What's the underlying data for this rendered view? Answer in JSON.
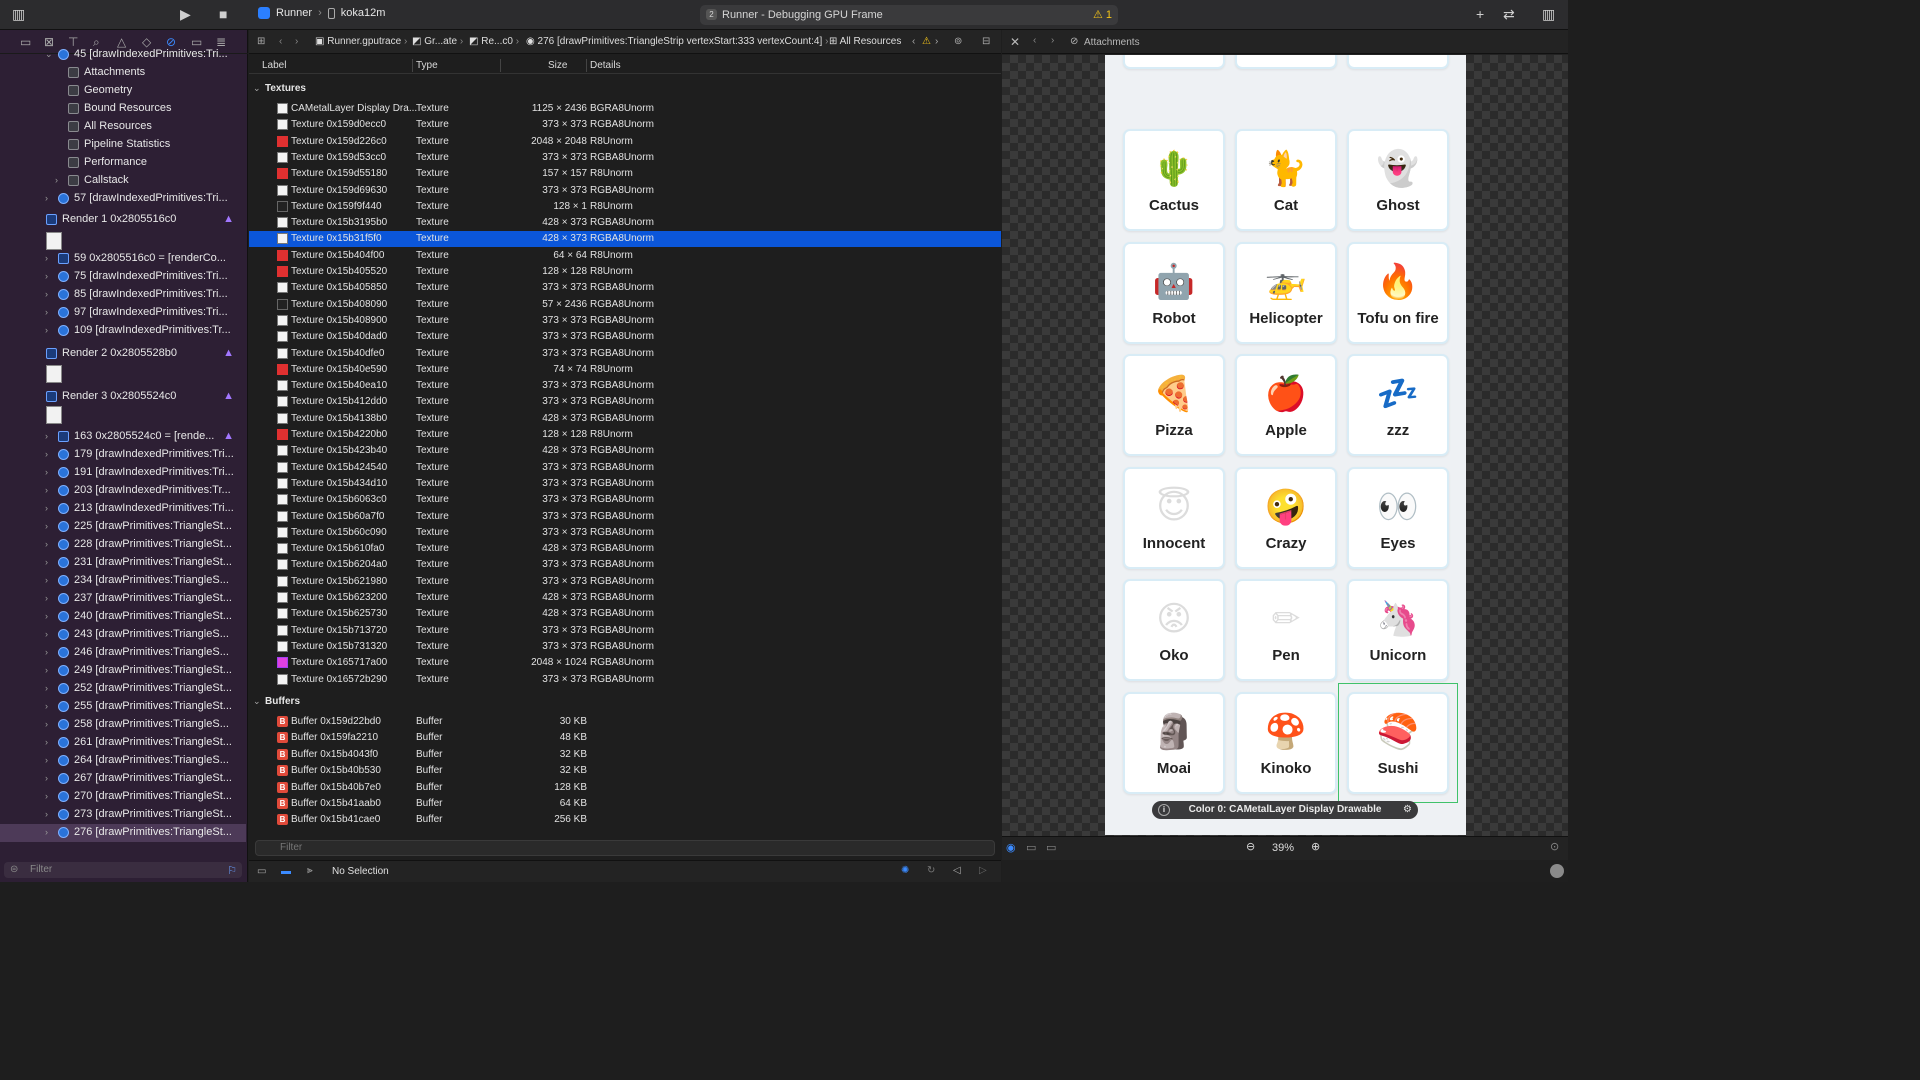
{
  "toolbar": {
    "scheme_name": "Runner",
    "device_name": "koka12m",
    "activity_badge": "2",
    "activity_title": "Runner - Debugging GPU Frame",
    "warning_count": "1"
  },
  "sidebar": {
    "rows": [
      {
        "label": "45 [drawIndexedPrimitives:Tri...",
        "indent": 1,
        "icon": "draw",
        "expanded": true
      },
      {
        "label": "Attachments",
        "indent": 2,
        "icon": "attachments"
      },
      {
        "label": "Geometry",
        "indent": 2,
        "icon": "geometry"
      },
      {
        "label": "Bound Resources",
        "indent": 2,
        "icon": "bound-resources"
      },
      {
        "label": "All Resources",
        "indent": 2,
        "icon": "all-resources"
      },
      {
        "label": "Pipeline Statistics",
        "indent": 2,
        "icon": "pipeline-statistics"
      },
      {
        "label": "Performance",
        "indent": 2,
        "icon": "performance"
      },
      {
        "label": "Callstack",
        "indent": 2,
        "icon": "callstack",
        "collapsed": true
      },
      {
        "label": "57 [drawIndexedPrimitives:Tri...",
        "indent": 1,
        "icon": "draw",
        "collapsed": true
      },
      {
        "label": "Render 1 0x2805516c0",
        "indent": 0,
        "icon": "render",
        "warn": true
      },
      {
        "label": "59 0x2805516c0 = [renderCo...",
        "indent": 1,
        "icon": "cmd",
        "collapsed": true
      },
      {
        "label": "75 [drawIndexedPrimitives:Tri...",
        "indent": 1,
        "icon": "draw",
        "collapsed": true
      },
      {
        "label": "85 [drawIndexedPrimitives:Tri...",
        "indent": 1,
        "icon": "draw",
        "collapsed": true
      },
      {
        "label": "97 [drawIndexedPrimitives:Tri...",
        "indent": 1,
        "icon": "draw",
        "collapsed": true
      },
      {
        "label": "109 [drawIndexedPrimitives:Tr...",
        "indent": 1,
        "icon": "draw",
        "collapsed": true
      },
      {
        "label": "Render 2 0x2805528b0",
        "indent": 0,
        "icon": "render",
        "warn": true
      },
      {
        "label": "Render 3 0x2805524c0",
        "indent": 0,
        "icon": "render",
        "warn": true
      },
      {
        "label": "163 0x2805524c0 = [rende...",
        "indent": 1,
        "icon": "cmd",
        "collapsed": true,
        "warn": true
      },
      {
        "label": "179 [drawIndexedPrimitives:Tri...",
        "indent": 1,
        "icon": "draw",
        "collapsed": true
      },
      {
        "label": "191 [drawIndexedPrimitives:Tri...",
        "indent": 1,
        "icon": "draw",
        "collapsed": true
      },
      {
        "label": "203 [drawIndexedPrimitives:Tr...",
        "indent": 1,
        "icon": "draw",
        "collapsed": true
      },
      {
        "label": "213 [drawIndexedPrimitives:Tri...",
        "indent": 1,
        "icon": "draw",
        "collapsed": true
      },
      {
        "label": "225 [drawPrimitives:TriangleSt...",
        "indent": 1,
        "icon": "draw",
        "collapsed": true
      },
      {
        "label": "228 [drawPrimitives:TriangleSt...",
        "indent": 1,
        "icon": "draw",
        "collapsed": true
      },
      {
        "label": "231 [drawPrimitives:TriangleSt...",
        "indent": 1,
        "icon": "draw",
        "collapsed": true
      },
      {
        "label": "234 [drawPrimitives:TriangleS...",
        "indent": 1,
        "icon": "draw",
        "collapsed": true
      },
      {
        "label": "237 [drawPrimitives:TriangleSt...",
        "indent": 1,
        "icon": "draw",
        "collapsed": true
      },
      {
        "label": "240 [drawPrimitives:TriangleSt...",
        "indent": 1,
        "icon": "draw",
        "collapsed": true
      },
      {
        "label": "243 [drawPrimitives:TriangleS...",
        "indent": 1,
        "icon": "draw",
        "collapsed": true
      },
      {
        "label": "246 [drawPrimitives:TriangleS...",
        "indent": 1,
        "icon": "draw",
        "collapsed": true
      },
      {
        "label": "249 [drawPrimitives:TriangleSt...",
        "indent": 1,
        "icon": "draw",
        "collapsed": true
      },
      {
        "label": "252 [drawPrimitives:TriangleSt...",
        "indent": 1,
        "icon": "draw",
        "collapsed": true
      },
      {
        "label": "255 [drawPrimitives:TriangleSt...",
        "indent": 1,
        "icon": "draw",
        "collapsed": true
      },
      {
        "label": "258 [drawPrimitives:TriangleS...",
        "indent": 1,
        "icon": "draw",
        "collapsed": true
      },
      {
        "label": "261 [drawPrimitives:TriangleSt...",
        "indent": 1,
        "icon": "draw",
        "collapsed": true
      },
      {
        "label": "264 [drawPrimitives:TriangleS...",
        "indent": 1,
        "icon": "draw",
        "collapsed": true
      },
      {
        "label": "267 [drawPrimitives:TriangleSt...",
        "indent": 1,
        "icon": "draw",
        "collapsed": true
      },
      {
        "label": "270 [drawPrimitives:TriangleSt...",
        "indent": 1,
        "icon": "draw",
        "collapsed": true
      },
      {
        "label": "273 [drawPrimitives:TriangleSt...",
        "indent": 1,
        "icon": "draw",
        "collapsed": true
      },
      {
        "label": "276 [drawPrimitives:TriangleSt...",
        "indent": 1,
        "icon": "draw",
        "collapsed": true,
        "selected": true
      }
    ],
    "filter_placeholder": "Filter"
  },
  "jumpbar": {
    "crumbs": [
      "Runner.gputrace",
      "Gr...ate",
      "Re...c0",
      "276 [drawPrimitives:TriangleStrip vertexStart:333 vertexCount:4]",
      "All Resources"
    ]
  },
  "resources": {
    "columns": [
      "Label",
      "Type",
      "Size",
      "Details"
    ],
    "texture_group": "Textures",
    "buffer_group": "Buffers",
    "textures": [
      {
        "label": "CAMetalLayer Display Dra...",
        "type": "Texture",
        "size": "1125 × 2436",
        "details": "BGRA8Unorm",
        "thumb": "white"
      },
      {
        "label": "Texture 0x159d0ecc0",
        "type": "Texture",
        "size": "373 × 373",
        "details": "RGBA8Unorm",
        "thumb": "white"
      },
      {
        "label": "Texture 0x159d226c0",
        "type": "Texture",
        "size": "2048 × 2048",
        "details": "R8Unorm",
        "thumb": "red"
      },
      {
        "label": "Texture 0x159d53cc0",
        "type": "Texture",
        "size": "373 × 373",
        "details": "RGBA8Unorm",
        "thumb": "white"
      },
      {
        "label": "Texture 0x159d55180",
        "type": "Texture",
        "size": "157 × 157",
        "details": "R8Unorm",
        "thumb": "red"
      },
      {
        "label": "Texture 0x159d69630",
        "type": "Texture",
        "size": "373 × 373",
        "details": "RGBA8Unorm",
        "thumb": "white"
      },
      {
        "label": "Texture 0x159f9f440",
        "type": "Texture",
        "size": "128 × 1",
        "details": "R8Unorm",
        "thumb": "dark"
      },
      {
        "label": "Texture 0x15b3195b0",
        "type": "Texture",
        "size": "428 × 373",
        "details": "RGBA8Unorm",
        "thumb": "white"
      },
      {
        "label": "Texture 0x15b31f5f0",
        "type": "Texture",
        "size": "428 × 373",
        "details": "RGBA8Unorm",
        "thumb": "white",
        "selected": true
      },
      {
        "label": "Texture 0x15b404f00",
        "type": "Texture",
        "size": "64 × 64",
        "details": "R8Unorm",
        "thumb": "red"
      },
      {
        "label": "Texture 0x15b405520",
        "type": "Texture",
        "size": "128 × 128",
        "details": "R8Unorm",
        "thumb": "red"
      },
      {
        "label": "Texture 0x15b405850",
        "type": "Texture",
        "size": "373 × 373",
        "details": "RGBA8Unorm",
        "thumb": "white"
      },
      {
        "label": "Texture 0x15b408090",
        "type": "Texture",
        "size": "57 × 2436",
        "details": "RGBA8Unorm",
        "thumb": "dark"
      },
      {
        "label": "Texture 0x15b408900",
        "type": "Texture",
        "size": "373 × 373",
        "details": "RGBA8Unorm",
        "thumb": "white"
      },
      {
        "label": "Texture 0x15b40dad0",
        "type": "Texture",
        "size": "373 × 373",
        "details": "RGBA8Unorm",
        "thumb": "white"
      },
      {
        "label": "Texture 0x15b40dfe0",
        "type": "Texture",
        "size": "373 × 373",
        "details": "RGBA8Unorm",
        "thumb": "white"
      },
      {
        "label": "Texture 0x15b40e590",
        "type": "Texture",
        "size": "74 × 74",
        "details": "R8Unorm",
        "thumb": "red"
      },
      {
        "label": "Texture 0x15b40ea10",
        "type": "Texture",
        "size": "373 × 373",
        "details": "RGBA8Unorm",
        "thumb": "white"
      },
      {
        "label": "Texture 0x15b412dd0",
        "type": "Texture",
        "size": "373 × 373",
        "details": "RGBA8Unorm",
        "thumb": "white"
      },
      {
        "label": "Texture 0x15b4138b0",
        "type": "Texture",
        "size": "428 × 373",
        "details": "RGBA8Unorm",
        "thumb": "white"
      },
      {
        "label": "Texture 0x15b4220b0",
        "type": "Texture",
        "size": "128 × 128",
        "details": "R8Unorm",
        "thumb": "red"
      },
      {
        "label": "Texture 0x15b423b40",
        "type": "Texture",
        "size": "428 × 373",
        "details": "RGBA8Unorm",
        "thumb": "white"
      },
      {
        "label": "Texture 0x15b424540",
        "type": "Texture",
        "size": "373 × 373",
        "details": "RGBA8Unorm",
        "thumb": "white"
      },
      {
        "label": "Texture 0x15b434d10",
        "type": "Texture",
        "size": "373 × 373",
        "details": "RGBA8Unorm",
        "thumb": "white"
      },
      {
        "label": "Texture 0x15b6063c0",
        "type": "Texture",
        "size": "373 × 373",
        "details": "RGBA8Unorm",
        "thumb": "white"
      },
      {
        "label": "Texture 0x15b60a7f0",
        "type": "Texture",
        "size": "373 × 373",
        "details": "RGBA8Unorm",
        "thumb": "white"
      },
      {
        "label": "Texture 0x15b60c090",
        "type": "Texture",
        "size": "373 × 373",
        "details": "RGBA8Unorm",
        "thumb": "white"
      },
      {
        "label": "Texture 0x15b610fa0",
        "type": "Texture",
        "size": "428 × 373",
        "details": "RGBA8Unorm",
        "thumb": "white"
      },
      {
        "label": "Texture 0x15b6204a0",
        "type": "Texture",
        "size": "373 × 373",
        "details": "RGBA8Unorm",
        "thumb": "white"
      },
      {
        "label": "Texture 0x15b621980",
        "type": "Texture",
        "size": "373 × 373",
        "details": "RGBA8Unorm",
        "thumb": "white"
      },
      {
        "label": "Texture 0x15b623200",
        "type": "Texture",
        "size": "428 × 373",
        "details": "RGBA8Unorm",
        "thumb": "white"
      },
      {
        "label": "Texture 0x15b625730",
        "type": "Texture",
        "size": "428 × 373",
        "details": "RGBA8Unorm",
        "thumb": "white"
      },
      {
        "label": "Texture 0x15b713720",
        "type": "Texture",
        "size": "373 × 373",
        "details": "RGBA8Unorm",
        "thumb": "white"
      },
      {
        "label": "Texture 0x15b731320",
        "type": "Texture",
        "size": "373 × 373",
        "details": "RGBA8Unorm",
        "thumb": "white"
      },
      {
        "label": "Texture 0x165717a00",
        "type": "Texture",
        "size": "2048 × 1024",
        "details": "RGBA8Unorm",
        "thumb": "magenta"
      },
      {
        "label": "Texture 0x16572b290",
        "type": "Texture",
        "size": "373 × 373",
        "details": "RGBA8Unorm",
        "thumb": "white"
      }
    ],
    "buffers": [
      {
        "label": "Buffer 0x159d22bd0",
        "type": "Buffer",
        "size": "30 KB"
      },
      {
        "label": "Buffer 0x159fa2210",
        "type": "Buffer",
        "size": "48 KB"
      },
      {
        "label": "Buffer 0x15b4043f0",
        "type": "Buffer",
        "size": "32 KB"
      },
      {
        "label": "Buffer 0x15b40b530",
        "type": "Buffer",
        "size": "32 KB"
      },
      {
        "label": "Buffer 0x15b40b7e0",
        "type": "Buffer",
        "size": "128 KB"
      },
      {
        "label": "Buffer 0x15b41aab0",
        "type": "Buffer",
        "size": "64 KB"
      },
      {
        "label": "Buffer 0x15b41cae0",
        "type": "Buffer",
        "size": "256 KB"
      }
    ],
    "filter_placeholder": "Filter"
  },
  "debugbar": {
    "status": "No Selection"
  },
  "right": {
    "title": "Attachments",
    "attachment_label": "Color 0: CAMetalLayer Display Drawable",
    "zoom": "39%",
    "cards": [
      {
        "emoji": "🌵",
        "name": "Cactus"
      },
      {
        "emoji": "🐈",
        "name": "Cat"
      },
      {
        "emoji": "👻",
        "name": "Ghost"
      },
      {
        "emoji": "🤖",
        "name": "Robot"
      },
      {
        "emoji": "🚁",
        "name": "Helicopter"
      },
      {
        "emoji": "🔥",
        "name": "Tofu on fire"
      },
      {
        "emoji": "🍕",
        "name": "Pizza"
      },
      {
        "emoji": "🍎",
        "name": "Apple"
      },
      {
        "emoji": "💤",
        "name": "zzz"
      },
      {
        "emoji": "😇",
        "name": "Innocent"
      },
      {
        "emoji": "🤪",
        "name": "Crazy"
      },
      {
        "emoji": "👀",
        "name": "Eyes"
      },
      {
        "emoji": "😡",
        "name": "Oko"
      },
      {
        "emoji": "✏",
        "name": "Pen"
      },
      {
        "emoji": "🦄",
        "name": "Unicorn"
      },
      {
        "emoji": "🗿",
        "name": "Moai"
      },
      {
        "emoji": "🍄",
        "name": "Kinoko"
      },
      {
        "emoji": "🍣",
        "name": "Sushi"
      }
    ]
  }
}
